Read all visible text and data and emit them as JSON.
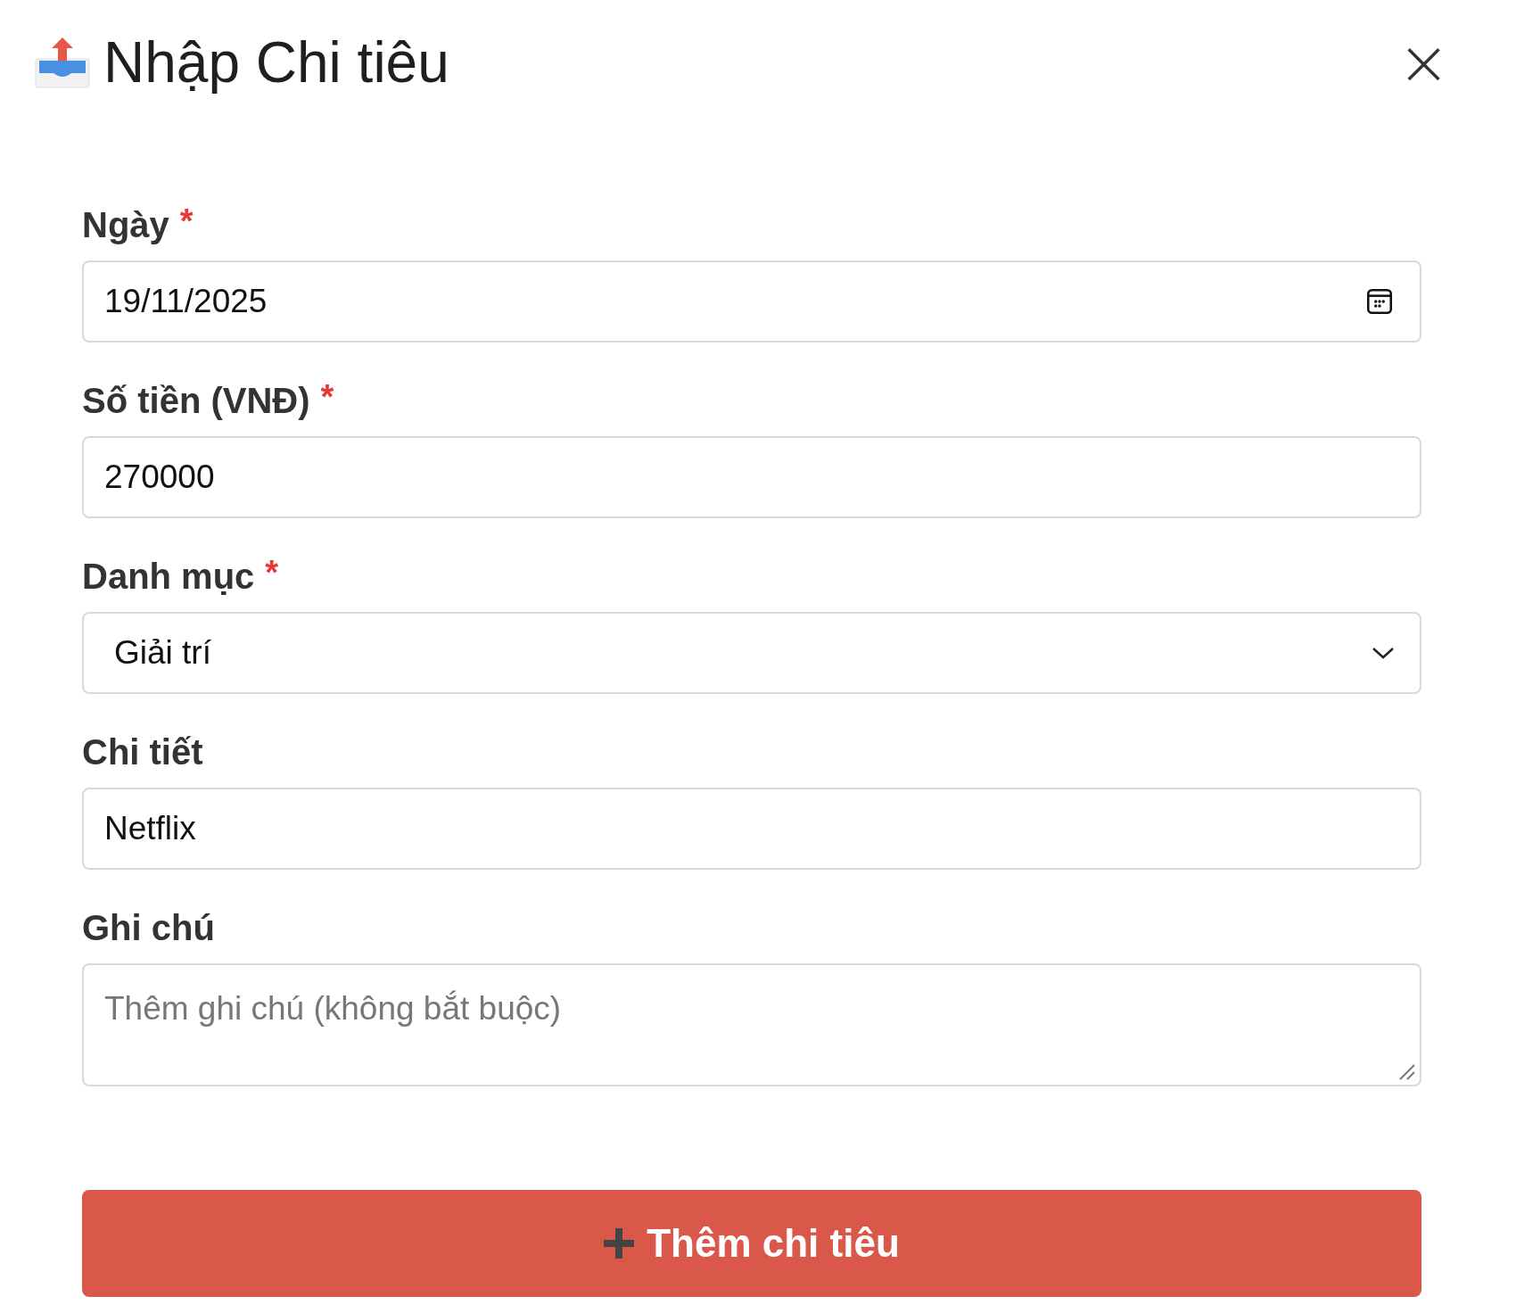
{
  "dialog": {
    "title": "Nhập Chi tiêu",
    "close": "×"
  },
  "fields": [
    {
      "kind": "date",
      "label": "Ngày",
      "required_mark": "*",
      "value": "19/11/2025"
    },
    {
      "kind": "text",
      "label": "Số tiền (VNĐ)",
      "required_mark": "*",
      "value": "270000"
    },
    {
      "kind": "select",
      "label": "Danh mục",
      "required_mark": "*",
      "value": "Giải trí"
    },
    {
      "kind": "text",
      "label": "Chi tiết",
      "value": "Netflix"
    },
    {
      "kind": "textarea",
      "label": "Ghi chú",
      "placeholder": "Thêm ghi chú (không bắt buộc)"
    }
  ],
  "submit_button": {
    "label": "Thêm chi tiêu"
  }
}
